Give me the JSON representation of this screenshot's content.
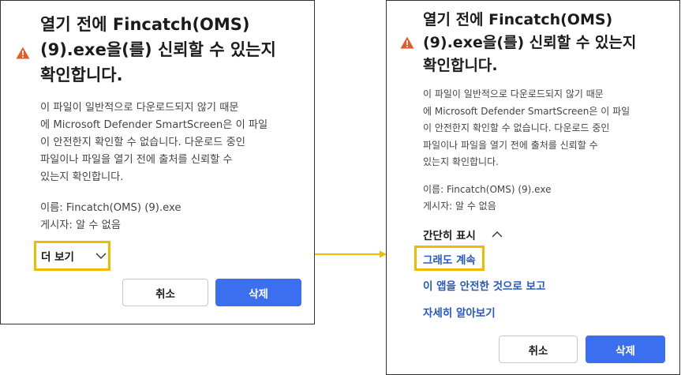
{
  "colors": {
    "accent_blue": "#3b6ff0",
    "link_blue": "#2559c5",
    "highlight_yellow": "#f5b800",
    "warning_orange": "#e8592a"
  },
  "left_dialog": {
    "title": "열기 전에 Fincatch(OMS)\n(9).exe을(를) 신뢰할 수 있는지\n확인합니다.",
    "icon": "warning-icon",
    "body": "이 파일이 일반적으로 다운로드되지 않기 때문\n에 Microsoft Defender SmartScreen은 이 파일\n이 안전한지 확인할 수 없습니다. 다운로드 중인\n파일이나 파일을 열기 전에 출처를 신뢰할 수\n있는지 확인합니다.",
    "name_line": "이름: Fincatch(OMS) (9).exe",
    "publisher_line": "게시자: 알 수 없음",
    "more_label": "더 보기",
    "cancel_label": "취소",
    "delete_label": "삭제"
  },
  "right_dialog": {
    "title": "열기 전에 Fincatch(OMS)\n(9).exe을(를) 신뢰할 수 있는지\n확인합니다.",
    "icon": "warning-icon",
    "body": "이 파일이 일반적으로 다운로드되지 않기 때문\n에 Microsoft Defender SmartScreen은 이 파일\n이 안전한지 확인할 수 없습니다. 다운로드 중인\n파일이나 파일을 열기 전에 출처를 신뢰할 수\n있는지 확인합니다.",
    "name_line": "이름: Fincatch(OMS) (9).exe",
    "publisher_line": "게시자: 알 수 없음",
    "less_label": "간단히 표시",
    "keep_anyway_label": "그래도 계속",
    "report_safe_label": "이 앱을 안전한 것으로 보고",
    "learn_more_label": "자세히 알아보기",
    "cancel_label": "취소",
    "delete_label": "삭제"
  }
}
